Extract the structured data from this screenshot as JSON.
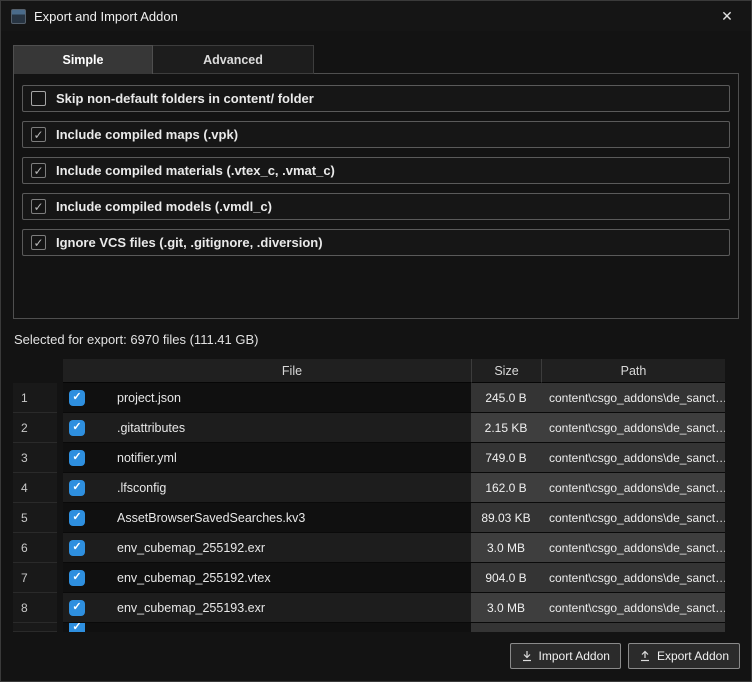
{
  "window": {
    "title": "Export and Import Addon"
  },
  "icons": {
    "check": "✓",
    "close": "✕"
  },
  "colors": {
    "accent_blue": "#2e8fdf",
    "panel_border": "#4f4f4f"
  },
  "tabs": [
    {
      "label": "Simple",
      "active": true
    },
    {
      "label": "Advanced",
      "active": false
    }
  ],
  "options": [
    {
      "label": "Skip non-default folders in content/ folder",
      "checked": false
    },
    {
      "label": "Include compiled maps (.vpk)",
      "checked": true
    },
    {
      "label": "Include compiled materials (.vtex_c, .vmat_c)",
      "checked": true
    },
    {
      "label": "Include compiled models (.vmdl_c)",
      "checked": true
    },
    {
      "label": "Ignore VCS files (.git, .gitignore, .diversion)",
      "checked": true
    }
  ],
  "summary": "Selected for export: 6970 files (111.41 GB)",
  "table": {
    "columns": {
      "file": "File",
      "size": "Size",
      "path": "Path"
    },
    "rows": [
      {
        "num": "1",
        "checked": true,
        "file": "project.json",
        "size": "245.0 B",
        "path": "content\\csgo_addons\\de_sanct…"
      },
      {
        "num": "2",
        "checked": true,
        "file": ".gitattributes",
        "size": "2.15 KB",
        "path": "content\\csgo_addons\\de_sanct…"
      },
      {
        "num": "3",
        "checked": true,
        "file": "notifier.yml",
        "size": "749.0 B",
        "path": "content\\csgo_addons\\de_sanct…"
      },
      {
        "num": "4",
        "checked": true,
        "file": ".lfsconfig",
        "size": "162.0 B",
        "path": "content\\csgo_addons\\de_sanct…"
      },
      {
        "num": "5",
        "checked": true,
        "file": "AssetBrowserSavedSearches.kv3",
        "size": "89.03 KB",
        "path": "content\\csgo_addons\\de_sanct…"
      },
      {
        "num": "6",
        "checked": true,
        "file": "env_cubemap_255192.exr",
        "size": "3.0 MB",
        "path": "content\\csgo_addons\\de_sanct…"
      },
      {
        "num": "7",
        "checked": true,
        "file": "env_cubemap_255192.vtex",
        "size": "904.0 B",
        "path": "content\\csgo_addons\\de_sanct…"
      },
      {
        "num": "8",
        "checked": true,
        "file": "env_cubemap_255193.exr",
        "size": "3.0 MB",
        "path": "content\\csgo_addons\\de_sanct…"
      }
    ],
    "partial_row": {
      "checked": true
    }
  },
  "footer": {
    "import_label": "Import Addon",
    "export_label": "Export Addon"
  }
}
